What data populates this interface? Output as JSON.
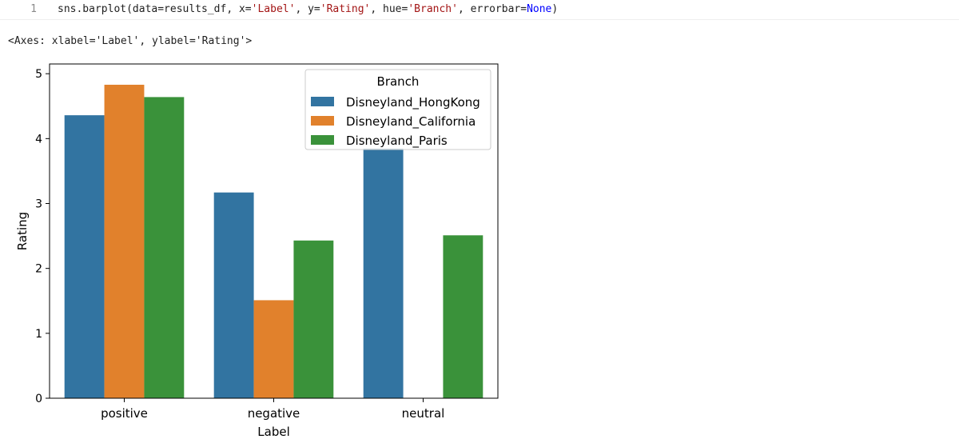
{
  "code_cell": {
    "line_number": "1",
    "tokens": [
      {
        "text": "sns.barplot(data=results_df, x=",
        "cls": ""
      },
      {
        "text": "'Label'",
        "cls": "tok-str"
      },
      {
        "text": ", y=",
        "cls": ""
      },
      {
        "text": "'Rating'",
        "cls": "tok-str"
      },
      {
        "text": ", hue=",
        "cls": ""
      },
      {
        "text": "'Branch'",
        "cls": "tok-str"
      },
      {
        "text": ", errorbar=",
        "cls": ""
      },
      {
        "text": "None",
        "cls": "tok-kw"
      },
      {
        "text": ")",
        "cls": ""
      }
    ]
  },
  "output": {
    "repr_text": "<Axes: xlabel='Label', ylabel='Rating'>"
  },
  "chart_data": {
    "type": "bar",
    "title": "",
    "xlabel": "Label",
    "ylabel": "Rating",
    "categories": [
      "positive",
      "negative",
      "neutral"
    ],
    "ylim": [
      0,
      5.15
    ],
    "yticks": [
      0,
      1,
      2,
      3,
      4,
      5
    ],
    "grid": false,
    "legend": {
      "title": "Branch",
      "placement": "top-right"
    },
    "series": [
      {
        "name": "Disneyland_HongKong",
        "color": "#3274a1",
        "values": [
          4.36,
          3.17,
          3.85
        ]
      },
      {
        "name": "Disneyland_California",
        "color": "#e1812c",
        "values": [
          4.83,
          1.51,
          null
        ]
      },
      {
        "name": "Disneyland_Paris",
        "color": "#3a923a",
        "values": [
          4.64,
          2.43,
          2.51
        ]
      }
    ]
  }
}
